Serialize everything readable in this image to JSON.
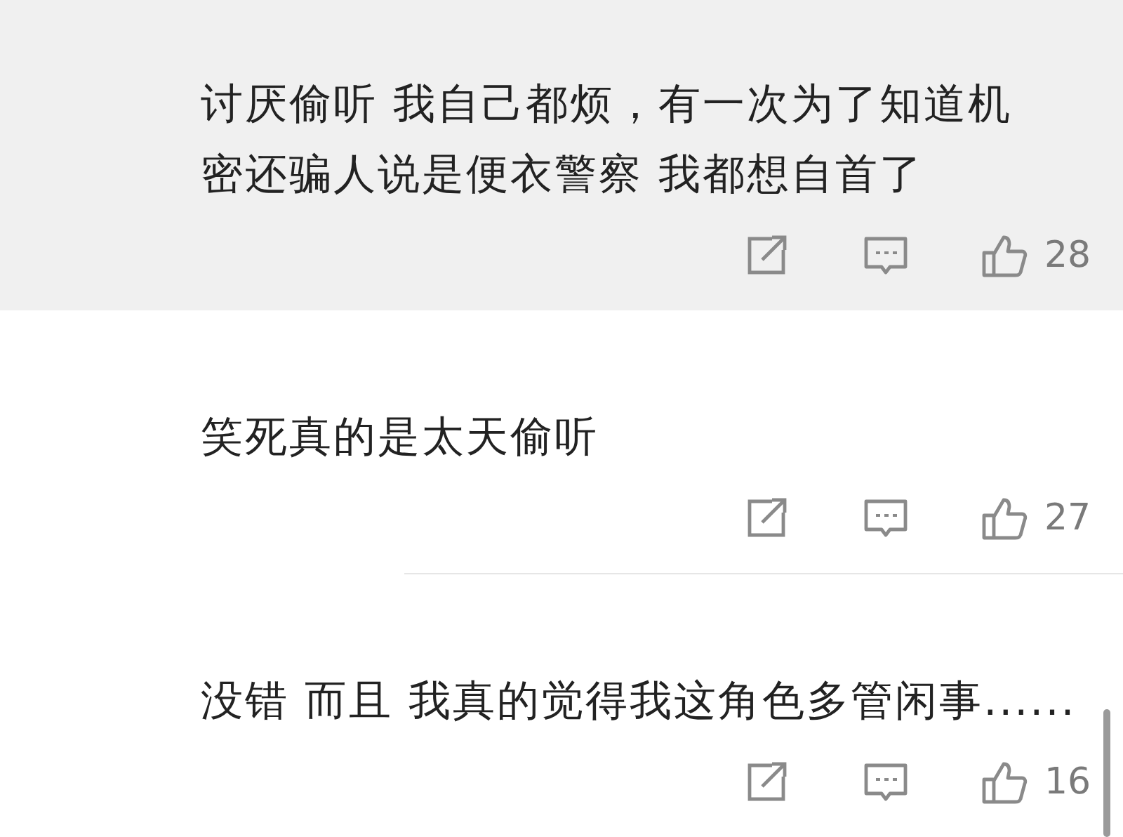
{
  "comments": [
    {
      "text": "讨厌偷听 我自己都烦，有一次为了知道机密还骗人说是便衣警察 我都想自首了",
      "likes": "28",
      "highlighted": true
    },
    {
      "text": "笑死真的是太天偷听",
      "likes": "27",
      "highlighted": false
    },
    {
      "text": "没错 而且 我真的觉得我这角色多管闲事......",
      "likes": "16",
      "highlighted": false
    }
  ]
}
